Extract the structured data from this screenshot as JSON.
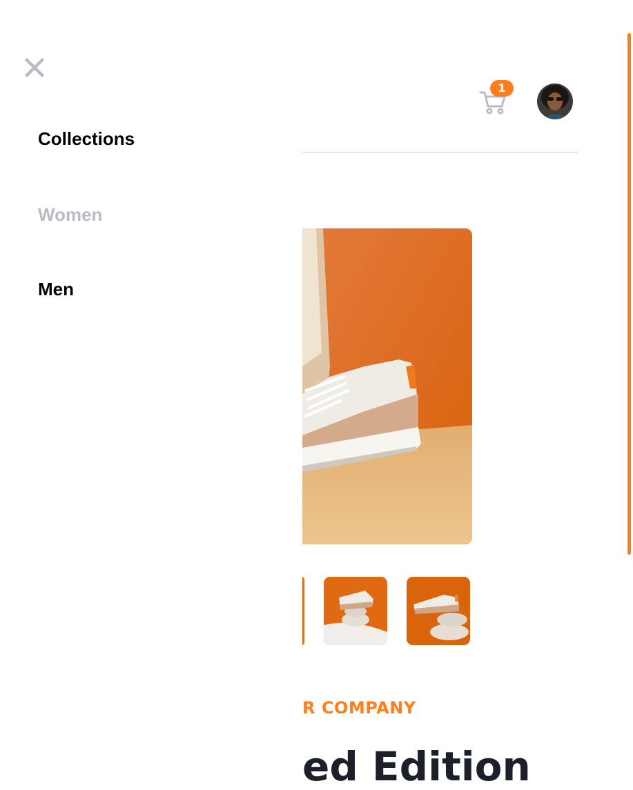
{
  "header": {
    "cart_count": "1",
    "cart_icon": "cart-icon",
    "avatar_icon": "avatar"
  },
  "menu": {
    "close_icon": "close-icon",
    "items": [
      {
        "label": "Collections",
        "state": "default"
      },
      {
        "label": "Women",
        "state": "muted"
      },
      {
        "label": "Men",
        "state": "default"
      }
    ]
  },
  "product": {
    "company": "R COMPANY",
    "title": "ed Edition"
  },
  "colors": {
    "accent": "#ff7e1b",
    "text_dark": "#000000",
    "text_muted": "#b6bcc8",
    "divider": "#c9c9c9",
    "cart_icon": "#b6bcc8",
    "title": "#1c202b"
  }
}
